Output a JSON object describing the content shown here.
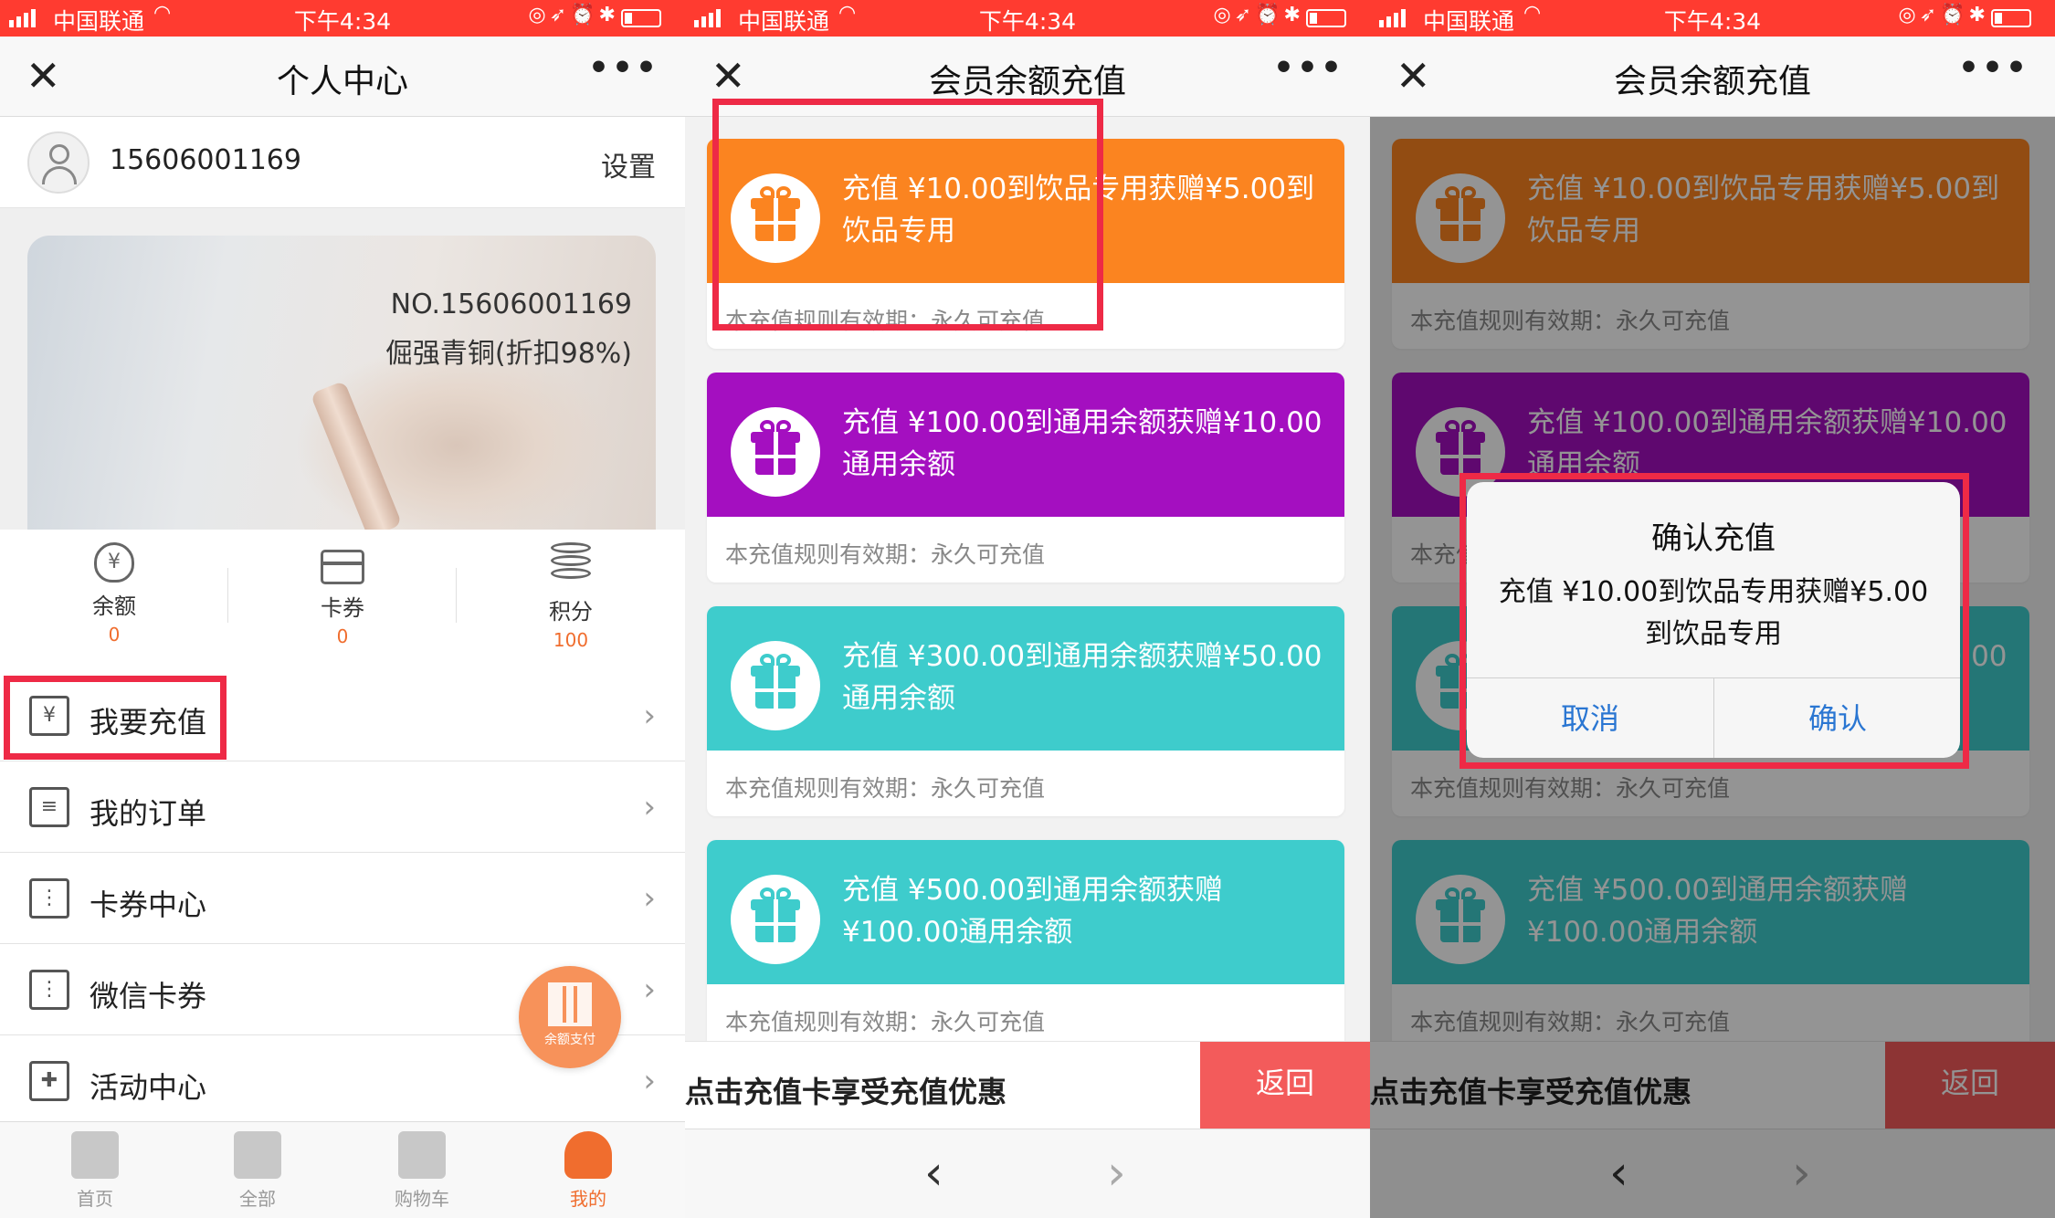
{
  "status": {
    "carrier": "中国联通",
    "time": "下午4:34"
  },
  "profile": {
    "nav_title": "个人中心",
    "phone": "15606001169",
    "settings": "设置",
    "card_no": "NO.15606001169",
    "card_level": "倔强青铜(折扣98%)",
    "stats": [
      {
        "label": "余额",
        "value": "0",
        "icon": "money-bag-icon"
      },
      {
        "label": "卡券",
        "value": "0",
        "icon": "card-icon"
      },
      {
        "label": "积分",
        "value": "100",
        "icon": "coins-icon"
      }
    ],
    "menu": [
      {
        "label": "我要充值",
        "icon": "recharge-icon"
      },
      {
        "label": "我的订单",
        "icon": "order-icon"
      },
      {
        "label": "卡券中心",
        "icon": "coupon-icon"
      },
      {
        "label": "微信卡券",
        "icon": "coupon-icon"
      },
      {
        "label": "活动中心",
        "icon": "gift-icon"
      }
    ],
    "qr_label": "余额支付",
    "tabs": [
      {
        "label": "首页",
        "icon": "home-icon"
      },
      {
        "label": "全部",
        "icon": "grid-icon"
      },
      {
        "label": "购物车",
        "icon": "cart-icon"
      },
      {
        "label": "我的",
        "icon": "user-icon",
        "active": true
      }
    ]
  },
  "recharge": {
    "nav_title": "会员余额充值",
    "cards": [
      {
        "text": "充值 ¥10.00到饮品专用获赠¥5.00到饮品专用",
        "rule": "本充值规则有效期：永久可充值",
        "color": "#fb8420"
      },
      {
        "text": "充值 ¥100.00到通用余额获赠¥10.00通用余额",
        "rule": "本充值规则有效期：永久可充值",
        "color": "#a40fc0"
      },
      {
        "text": "充值 ¥300.00到通用余额获赠¥50.00通用余额",
        "rule": "本充值规则有效期：永久可充值",
        "color": "#3ecccc"
      },
      {
        "text": "充值 ¥500.00到通用余额获赠¥100.00通用余额",
        "rule": "本充值规则有效期：永久可充值",
        "color": "#3ecccc"
      }
    ],
    "promo": "点击充值卡享受充值优惠",
    "back": "返回"
  },
  "dialog": {
    "title": "确认充值",
    "message": "充值 ¥10.00到饮品专用获赠¥5.00到饮品专用",
    "cancel": "取消",
    "confirm": "确认"
  },
  "colors": {
    "status_bar": "#ff3b30",
    "accent": "#f06d2e",
    "highlight": "#ee2a46",
    "dialog_button": "#2a76d2"
  }
}
